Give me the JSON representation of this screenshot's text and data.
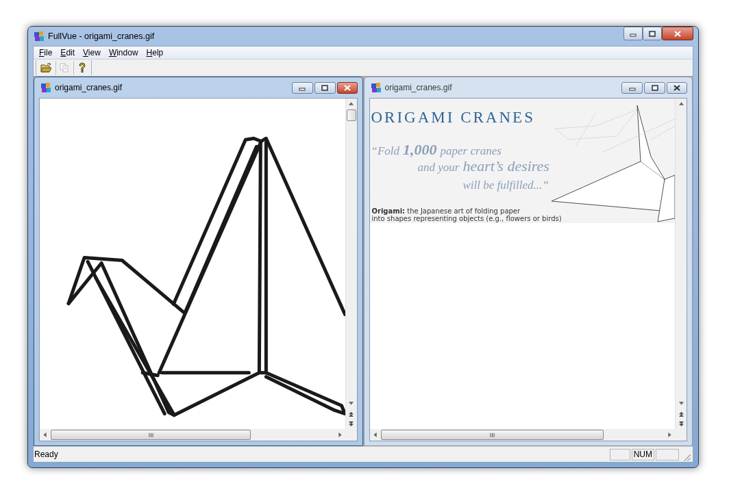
{
  "window": {
    "title": "FullVue - origami_cranes.gif"
  },
  "menu": [
    {
      "label": "File"
    },
    {
      "label": "Edit"
    },
    {
      "label": "View"
    },
    {
      "label": "Window"
    },
    {
      "label": "Help"
    }
  ],
  "toolbar": [
    {
      "kind": "open",
      "disabled": false
    },
    {
      "kind": "copy",
      "disabled": true
    },
    {
      "kind": "help",
      "disabled": false
    }
  ],
  "documents": [
    {
      "title": "origami_cranes.gif",
      "active": true,
      "content": {
        "kind": "zoomed_drawing"
      },
      "vertical_thumb": true
    },
    {
      "title": "origami_cranes.gif",
      "active": false,
      "vertical_thumb": false,
      "content": {
        "kind": "poster",
        "heading": "ORIGAMI CRANES",
        "quote_lines": [
          [
            {
              "text": "“Fold",
              "big": false
            },
            {
              "text": "1,000",
              "big": true
            },
            {
              "text": "paper cranes",
              "big": false
            }
          ],
          [
            {
              "text": "and your",
              "big": false
            },
            {
              "text": "heart’s desires",
              "big": true
            }
          ],
          [
            {
              "text": "will be fulfilled...”",
              "big": false
            }
          ]
        ],
        "caption_lines": [
          "**Origami:** the Japanese art of folding paper",
          "into shapes representing objects (e.g., flowers or birds)"
        ]
      }
    }
  ],
  "status_bar": {
    "text": "Ready",
    "indicators": [
      "NUM"
    ]
  }
}
